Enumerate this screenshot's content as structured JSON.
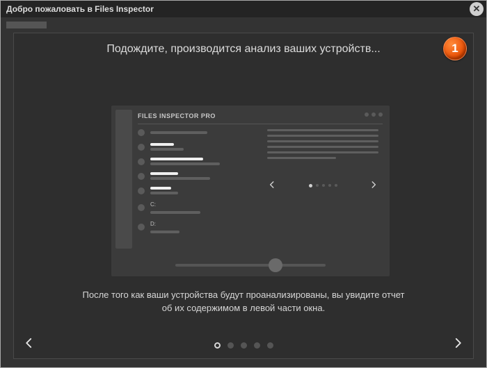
{
  "window": {
    "title": "Добро пожаловать в Files Inspector"
  },
  "badge": {
    "number": "1"
  },
  "slide": {
    "heading": "Подождите, производится анализ ваших устройств...",
    "subtext_line1": "После того как ваши устройства будут проанализированы, вы увидите отчет",
    "subtext_line2": "об их содержимом в левой части окна."
  },
  "mock": {
    "app_title": "FILES INSPECTOR PRO",
    "drive_c": "C:",
    "drive_d": "D:"
  },
  "pager": {
    "total": 5,
    "active_index": 0
  },
  "carousel": {
    "total": 5,
    "active_index": 0
  }
}
